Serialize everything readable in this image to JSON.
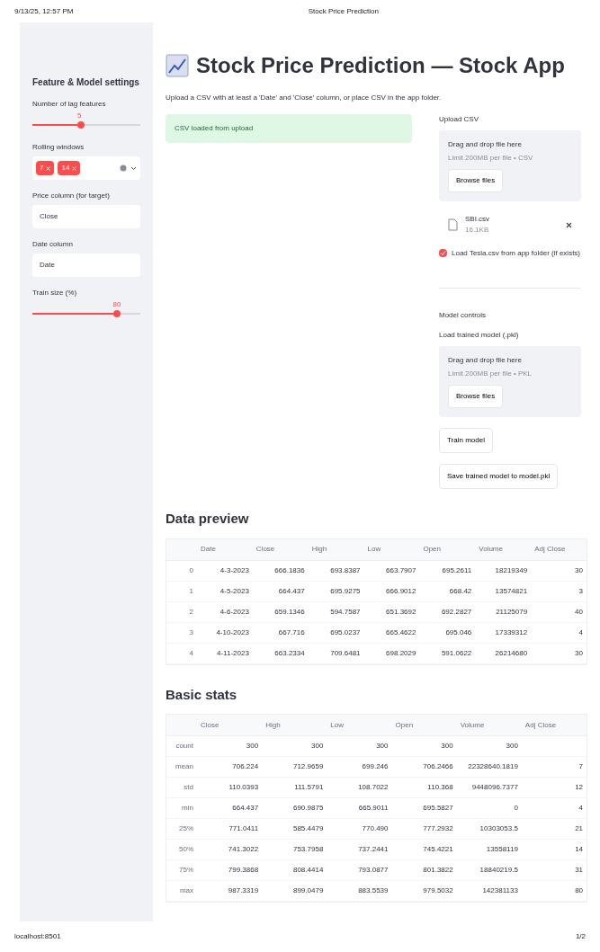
{
  "print_header": {
    "datetime": "9/13/25, 12:57 PM",
    "title": "Stock Price Prediction"
  },
  "sidebar": {
    "title": "Feature & Model settings",
    "controls": [
      {
        "kind": "slider",
        "label": "Number of lag features",
        "value": "5",
        "level": 0.45
      },
      {
        "kind": "multiselect",
        "label": "Rolling windows",
        "tags": [
          "7",
          "14"
        ]
      },
      {
        "kind": "text",
        "label": "Price column (for target)",
        "value": "Close"
      },
      {
        "kind": "text",
        "label": "Date column",
        "value": "Date"
      },
      {
        "kind": "slider",
        "label": "Train size (%)",
        "value": "80",
        "level": 0.78
      }
    ]
  },
  "main": {
    "title": "Stock Price Prediction — Stock App",
    "subtitle": "Upload a CSV with at least a 'Date' and 'Close' column, or place CSV in the app folder.",
    "alert": "CSV loaded from upload",
    "upload": {
      "label": "Upload CSV",
      "drop_text": "Drag and drop file here",
      "limit": "Limit 200MB per file • CSV",
      "button": "Browse files",
      "file": {
        "name": "SBI.csv",
        "size": "16.1KB"
      }
    },
    "checkbox": {
      "label": "Load Tesla.csv from app folder (if exists)",
      "checked": true
    },
    "model_controls": {
      "heading": "Model controls",
      "upload_label": "Load trained model (.pkl)",
      "drop_text": "Drag and drop file here",
      "limit": "Limit 200MB per file • PKL",
      "button": "Browse files",
      "buttons": [
        "Train model",
        "Save trained model to model.pkl"
      ]
    }
  },
  "data_preview": {
    "heading": "Data preview",
    "columns": [
      "Date",
      "Close",
      "High",
      "Low",
      "Open",
      "Volume",
      "Adj Close"
    ],
    "rows": [
      {
        "index": "0",
        "cells": [
          "4-3-2023",
          "666.1836",
          "693.8387",
          "663.7907",
          "695.2611",
          "18219349",
          "30"
        ]
      },
      {
        "index": "1",
        "cells": [
          "4-5-2023",
          "664.437",
          "695.9275",
          "666.9012",
          "668.42",
          "13574821",
          "3"
        ]
      },
      {
        "index": "2",
        "cells": [
          "4-6-2023",
          "659.1346",
          "594.7587",
          "651.3692",
          "692.2827",
          "21125079",
          "40"
        ]
      },
      {
        "index": "3",
        "cells": [
          "4-10-2023",
          "667.716",
          "695.0237",
          "665.4622",
          "695.046",
          "17339312",
          "4"
        ]
      },
      {
        "index": "4",
        "cells": [
          "4-11-2023",
          "663.2334",
          "709.6481",
          "698.2029",
          "591.0622",
          "26214680",
          "30"
        ]
      }
    ]
  },
  "basic_stats": {
    "heading": "Basic stats",
    "columns": [
      "Close",
      "High",
      "Low",
      "Open",
      "Volume",
      "Adj Close"
    ],
    "rows": [
      {
        "index": "count",
        "cells": [
          "300",
          "300",
          "300",
          "300",
          "300",
          ""
        ]
      },
      {
        "index": "mean",
        "cells": [
          "706.224",
          "712.9659",
          "699.246",
          "706.2466",
          "22328640.1819",
          "7"
        ]
      },
      {
        "index": "std",
        "cells": [
          "110.0393",
          "111.5791",
          "108.7022",
          "110.368",
          "9448096.7377",
          "12"
        ]
      },
      {
        "index": "min",
        "cells": [
          "664.437",
          "690.9875",
          "665.9011",
          "695.5827",
          "0",
          "4"
        ]
      },
      {
        "index": "25%",
        "cells": [
          "771.0411",
          "585.4479",
          "770.490",
          "777.2932",
          "10303053.5",
          "21"
        ]
      },
      {
        "index": "50%",
        "cells": [
          "741.3022",
          "753.7958",
          "737.2441",
          "745.4221",
          "13558119",
          "14"
        ]
      },
      {
        "index": "75%",
        "cells": [
          "799.3868",
          "808.4414",
          "793.0877",
          "801.3822",
          "18840219.5",
          "31"
        ]
      },
      {
        "index": "max",
        "cells": [
          "987.3319",
          "899.0479",
          "883.5539",
          "979.5032",
          "142381133",
          "80"
        ]
      }
    ]
  },
  "print_footer": {
    "url": "localhost:8501",
    "page": "1/2"
  }
}
